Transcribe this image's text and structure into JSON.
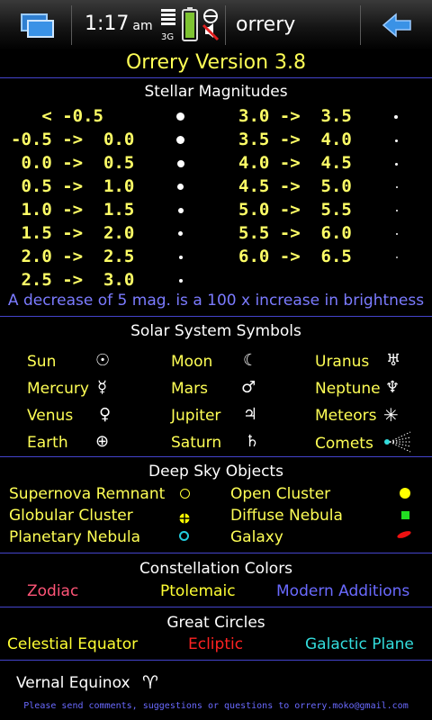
{
  "status": {
    "time": "1:17",
    "ampm": "am",
    "network": "3G",
    "app_title": "orrery",
    "icons": [
      "task-switcher-icon",
      "signal-icon",
      "battery-icon",
      "mute-icon",
      "back-arrow-icon"
    ]
  },
  "title": "Orrery Version 3.8",
  "magnitudes": {
    "heading": "Stellar Magnitudes",
    "left": [
      "   < -0.5",
      "-0.5 ->  0.0",
      " 0.0 ->  0.5",
      " 0.5 ->  1.0",
      " 1.0 ->  1.5",
      " 1.5 ->  2.0",
      " 2.0 ->  2.5",
      " 2.5 ->  3.0"
    ],
    "right": [
      "3.0 ->  3.5",
      "3.5 ->  4.0",
      "4.0 ->  4.5",
      "4.5 ->  5.0",
      "5.0 ->  5.5",
      "5.5 ->  6.0",
      "6.0 ->  6.5"
    ],
    "note": "A decrease of 5 mag. is a 100 x increase in brightness"
  },
  "solar": {
    "heading": "Solar System Symbols",
    "items": [
      {
        "name": "Sun",
        "symbol": "☉"
      },
      {
        "name": "Moon",
        "symbol": "☾"
      },
      {
        "name": "Uranus",
        "symbol": "♅"
      },
      {
        "name": "Mercury",
        "symbol": "☿"
      },
      {
        "name": "Mars",
        "symbol": "♂"
      },
      {
        "name": "Neptune",
        "symbol": "♆"
      },
      {
        "name": "Venus",
        "symbol": "♀"
      },
      {
        "name": "Jupiter",
        "symbol": "♃"
      },
      {
        "name": "Meteors",
        "symbol": "✳"
      },
      {
        "name": "Earth",
        "symbol": "⊕"
      },
      {
        "name": "Saturn",
        "symbol": "♄"
      },
      {
        "name": "Comets",
        "symbol": "comet"
      }
    ]
  },
  "deepsky": {
    "heading": "Deep Sky Objects",
    "items": [
      {
        "name": "Supernova Remnant"
      },
      {
        "name": "Open Cluster"
      },
      {
        "name": "Globular Cluster"
      },
      {
        "name": "Diffuse Nebula"
      },
      {
        "name": "Planetary Nebula"
      },
      {
        "name": "Galaxy"
      }
    ]
  },
  "constellation": {
    "heading": "Constellation Colors",
    "items": [
      {
        "name": "Zodiac",
        "color": "#ff5577"
      },
      {
        "name": "Ptolemaic",
        "color": "#ffff33"
      },
      {
        "name": "Modern Additions",
        "color": "#6a6aff"
      }
    ]
  },
  "circles": {
    "heading": "Great Circles",
    "items": [
      {
        "name": "Celestial Equator",
        "color": "#ffff33"
      },
      {
        "name": "Ecliptic",
        "color": "#ff2222"
      },
      {
        "name": "Galactic Plane",
        "color": "#33dddd"
      }
    ]
  },
  "vernal": {
    "label": "Vernal Equinox",
    "symbol": "♈"
  },
  "footer": "Please send comments, suggestions or questions to orrery.moko@gmail.com"
}
